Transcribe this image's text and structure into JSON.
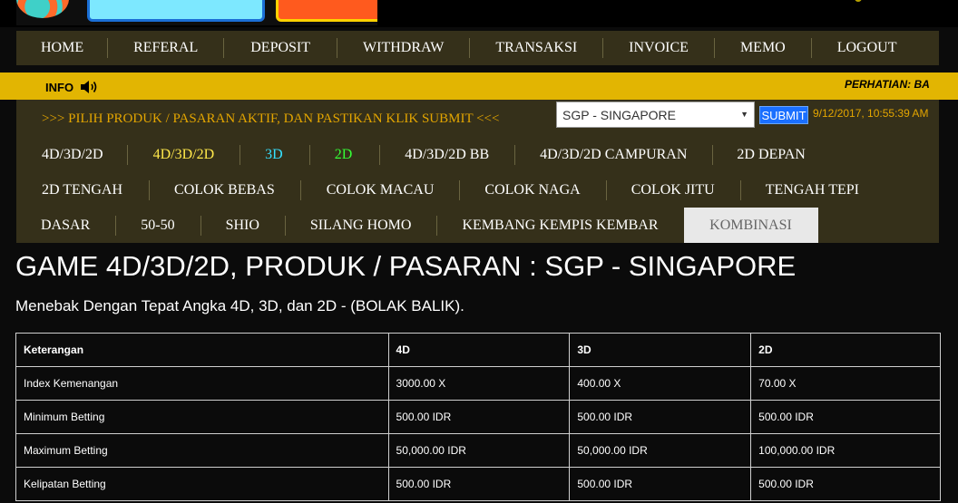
{
  "header": {
    "logo_icon": "lottery-ball-logo"
  },
  "nav": {
    "items": [
      "HOME",
      "REFERAL",
      "DEPOSIT",
      "WITHDRAW",
      "TRANSAKSI",
      "INVOICE",
      "MEMO",
      "LOGOUT"
    ]
  },
  "info": {
    "label": "INFO",
    "icon": "speaker-icon",
    "marquee": "PERHATIAN: BA"
  },
  "product_panel": {
    "instruction": ">>> PILIH PRODUK / PASARAN AKTIF, DAN PASTIKAN KLIK SUBMIT <<<",
    "market_select_value": "SGP - SINGAPORE",
    "submit_label": "SUBMIT",
    "datetime": "9/12/2017, 10:55:39 AM",
    "games_row1": [
      "4D/3D/2D",
      "4D/3D/2D",
      "3D",
      "2D",
      "4D/3D/2D BB",
      "4D/3D/2D CAMPURAN",
      "2D DEPAN"
    ],
    "games_row2": [
      "2D TENGAH",
      "COLOK BEBAS",
      "COLOK MACAU",
      "COLOK NAGA",
      "COLOK JITU",
      "TENGAH TEPI"
    ],
    "games_row3": [
      "DASAR",
      "50-50",
      "SHIO",
      "SILANG HOMO",
      "KEMBANG KEMPIS KEMBAR",
      "KOMBINASI"
    ],
    "active_game": "KOMBINASI",
    "colors": {
      "panel_bg": "#35301a",
      "instruction": "#e3a500",
      "yellow": "#ffe84a",
      "cyan": "#35e0ff",
      "green": "#35ff35"
    }
  },
  "main": {
    "title": "GAME 4D/3D/2D, PRODUK / PASARAN : SGP - SINGAPORE",
    "description": "Menebak Dengan Tepat Angka 4D, 3D, dan 2D - (BOLAK BALIK).",
    "table": {
      "headers": [
        "Keterangan",
        "4D",
        "3D",
        "2D"
      ],
      "rows": [
        [
          "Index Kemenangan",
          "3000.00 X",
          "400.00 X",
          "70.00 X"
        ],
        [
          "Minimum Betting",
          "500.00 IDR",
          "500.00 IDR",
          "500.00 IDR"
        ],
        [
          "Maximum Betting",
          "50,000.00 IDR",
          "50,000.00 IDR",
          "100,000.00 IDR"
        ],
        [
          "Kelipatan Betting",
          "500.00 IDR",
          "500.00 IDR",
          "500.00 IDR"
        ]
      ]
    }
  }
}
